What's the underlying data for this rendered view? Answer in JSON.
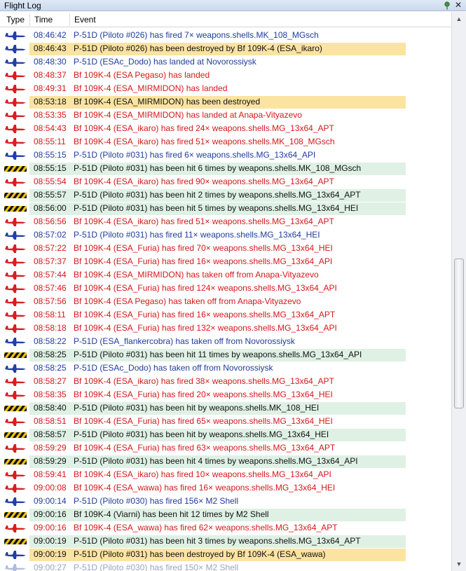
{
  "window": {
    "title": "Flight Log"
  },
  "columns": {
    "type": "Type",
    "time": "Time",
    "event": "Event"
  },
  "colors": {
    "blue_text": "#1f3c9b",
    "red_text": "#d3181a",
    "dark_text": "#111111",
    "destroyed_bg": "#fbe3a1",
    "hit_bg": "#dff1e4"
  },
  "rows": [
    {
      "icon": "blue-plane-icon",
      "style": "blue",
      "time": "08:46:42",
      "event": "P-51D (Piloto #026) has fired 7× weapons.shells.MK_108_MGsch"
    },
    {
      "icon": "blue-plane-icon",
      "style": "destroyed",
      "time": "08:46:43",
      "event": "P-51D (Piloto #026) has been destroyed by Bf 109K-4 (ESA_ikaro)"
    },
    {
      "icon": "blue-plane-icon",
      "style": "blue",
      "time": "08:48:30",
      "event": "P-51D (ESAc_Dodo) has landed at Novorossiysk"
    },
    {
      "icon": "red-plane-icon",
      "style": "red",
      "time": "08:48:37",
      "event": "Bf 109K-4 (ESA Pegaso) has landed"
    },
    {
      "icon": "red-plane-icon",
      "style": "red",
      "time": "08:49:31",
      "event": "Bf 109K-4 (ESA_MIRMIDON) has landed"
    },
    {
      "icon": "red-plane-icon",
      "style": "destroyed",
      "time": "08:53:18",
      "event": "Bf 109K-4 (ESA_MIRMIDON) has been destroyed"
    },
    {
      "icon": "red-plane-icon",
      "style": "red",
      "time": "08:53:35",
      "event": "Bf 109K-4 (ESA_MIRMIDON) has landed at Anapa-Vityazevo"
    },
    {
      "icon": "red-plane-icon",
      "style": "red",
      "time": "08:54:43",
      "event": "Bf 109K-4 (ESA_ikaro) has fired 24× weapons.shells.MG_13x64_APT"
    },
    {
      "icon": "red-plane-icon",
      "style": "red",
      "time": "08:55:11",
      "event": "Bf 109K-4 (ESA_ikaro) has fired 51× weapons.shells.MK_108_MGsch"
    },
    {
      "icon": "blue-plane-icon",
      "style": "blue",
      "time": "08:55:15",
      "event": "P-51D (Piloto #031) has fired 6× weapons.shells.MG_13x64_API"
    },
    {
      "icon": "hazard-stripe-icon",
      "style": "hit",
      "time": "08:55:15",
      "event": "P-51D (Piloto #031) has been hit 6 times by weapons.shells.MK_108_MGsch"
    },
    {
      "icon": "red-plane-icon",
      "style": "red",
      "time": "08:55:54",
      "event": "Bf 109K-4 (ESA_ikaro) has fired 90× weapons.shells.MG_13x64_APT"
    },
    {
      "icon": "hazard-stripe-icon",
      "style": "hit",
      "time": "08:55:57",
      "event": "P-51D (Piloto #031) has been hit 2 times by weapons.shells.MG_13x64_APT"
    },
    {
      "icon": "hazard-stripe-icon",
      "style": "hit",
      "time": "08:56:00",
      "event": "P-51D (Piloto #031) has been hit 5 times by weapons.shells.MG_13x64_HEI"
    },
    {
      "icon": "red-plane-icon",
      "style": "red",
      "time": "08:56:56",
      "event": "Bf 109K-4 (ESA_ikaro) has fired 51× weapons.shells.MG_13x64_APT"
    },
    {
      "icon": "blue-plane-icon",
      "style": "blue",
      "time": "08:57:02",
      "event": "P-51D (Piloto #031) has fired 11× weapons.shells.MG_13x64_HEI"
    },
    {
      "icon": "red-plane-icon",
      "style": "red",
      "time": "08:57:22",
      "event": "Bf 109K-4 (ESA_Furia) has fired 70× weapons.shells.MG_13x64_HEI"
    },
    {
      "icon": "red-plane-icon",
      "style": "red",
      "time": "08:57:37",
      "event": "Bf 109K-4 (ESA_Furia) has fired 16× weapons.shells.MG_13x64_API"
    },
    {
      "icon": "red-plane-icon",
      "style": "red",
      "time": "08:57:44",
      "event": "Bf 109K-4 (ESA_MIRMIDON) has taken off from Anapa-Vityazevo"
    },
    {
      "icon": "red-plane-icon",
      "style": "red",
      "time": "08:57:46",
      "event": "Bf 109K-4 (ESA_Furia) has fired 124× weapons.shells.MG_13x64_API"
    },
    {
      "icon": "red-plane-icon",
      "style": "red",
      "time": "08:57:56",
      "event": "Bf 109K-4 (ESA Pegaso) has taken off from Anapa-Vityazevo"
    },
    {
      "icon": "red-plane-icon",
      "style": "red",
      "time": "08:58:11",
      "event": "Bf 109K-4 (ESA_Furia) has fired 16× weapons.shells.MG_13x64_APT"
    },
    {
      "icon": "red-plane-icon",
      "style": "red",
      "time": "08:58:18",
      "event": "Bf 109K-4 (ESA_Furia) has fired 132× weapons.shells.MG_13x64_API"
    },
    {
      "icon": "blue-plane-icon",
      "style": "blue",
      "time": "08:58:22",
      "event": "P-51D (ESA_flankercobra) has taken off from Novorossiysk"
    },
    {
      "icon": "hazard-stripe-icon",
      "style": "hit",
      "time": "08:58:25",
      "event": "P-51D (Piloto #031) has been hit 11 times by weapons.shells.MG_13x64_API"
    },
    {
      "icon": "blue-plane-icon",
      "style": "blue",
      "time": "08:58:25",
      "event": "P-51D (ESAc_Dodo) has taken off from Novorossiysk"
    },
    {
      "icon": "red-plane-icon",
      "style": "red",
      "time": "08:58:27",
      "event": "Bf 109K-4 (ESA_ikaro) has fired 38× weapons.shells.MG_13x64_APT"
    },
    {
      "icon": "red-plane-icon",
      "style": "red",
      "time": "08:58:35",
      "event": "Bf 109K-4 (ESA_Furia) has fired 20× weapons.shells.MG_13x64_HEI"
    },
    {
      "icon": "hazard-stripe-icon",
      "style": "hit",
      "time": "08:58:40",
      "event": "P-51D (Piloto #031) has been hit by weapons.shells.MK_108_HEI"
    },
    {
      "icon": "red-plane-icon",
      "style": "red",
      "time": "08:58:51",
      "event": "Bf 109K-4 (ESA_Furia) has fired 65× weapons.shells.MG_13x64_HEI"
    },
    {
      "icon": "hazard-stripe-icon",
      "style": "hit",
      "time": "08:58:57",
      "event": "P-51D (Piloto #031) has been hit by weapons.shells.MG_13x64_HEI"
    },
    {
      "icon": "red-plane-icon",
      "style": "red",
      "time": "08:59:29",
      "event": "Bf 109K-4 (ESA_Furia) has fired 63× weapons.shells.MG_13x64_APT"
    },
    {
      "icon": "hazard-stripe-icon",
      "style": "hit",
      "time": "08:59:29",
      "event": "P-51D (Piloto #031) has been hit 4 times by weapons.shells.MG_13x64_API"
    },
    {
      "icon": "red-plane-icon",
      "style": "red",
      "time": "08:59:41",
      "event": "Bf 109K-4 (ESA_ikaro) has fired 10× weapons.shells.MG_13x64_API"
    },
    {
      "icon": "red-plane-icon",
      "style": "red",
      "time": "09:00:08",
      "event": "Bf 109K-4 (ESA_wawa) has fired 16× weapons.shells.MG_13x64_HEI"
    },
    {
      "icon": "blue-plane-icon",
      "style": "blue",
      "time": "09:00:14",
      "event": "P-51D (Piloto #030) has fired 156× M2 Shell"
    },
    {
      "icon": "hazard-stripe-icon",
      "style": "hit",
      "time": "09:00:16",
      "event": "Bf 109K-4 (Viarni) has been hit 12 times by M2 Shell"
    },
    {
      "icon": "red-plane-icon",
      "style": "red",
      "time": "09:00:16",
      "event": "Bf 109K-4 (ESA_wawa) has fired 62× weapons.shells.MG_13x64_APT"
    },
    {
      "icon": "hazard-stripe-icon",
      "style": "hit",
      "time": "09:00:19",
      "event": "P-51D (Piloto #031) has been hit 3 times by weapons.shells.MG_13x64_APT"
    },
    {
      "icon": "blue-plane-icon",
      "style": "destroyed",
      "time": "09:00:19",
      "event": "P-51D (Piloto #031) has been destroyed by Bf 109K-4 (ESA_wawa)"
    },
    {
      "icon": "blue-plane-icon",
      "style": "faded",
      "time": "09:00:27",
      "event": "P-51D (Piloto #030) has fired 150× M2 Shell"
    }
  ]
}
